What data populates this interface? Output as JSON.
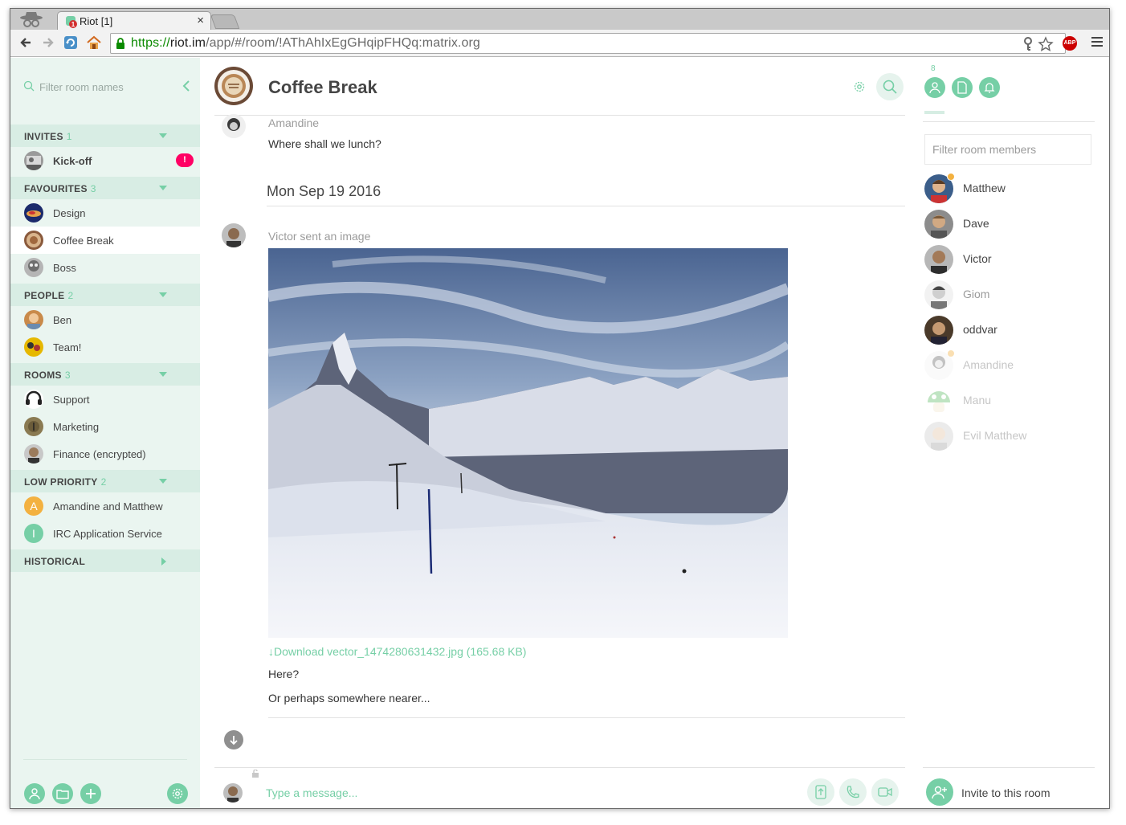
{
  "browser": {
    "tab_title": "Riot [1]",
    "tab_close": "×",
    "url_scheme": "https://",
    "url_host": "riot.im",
    "url_path": "/app/#/room/!AThAhIxEgGHqipFHQq:matrix.org",
    "abp_label": "ABP"
  },
  "left": {
    "filter_placeholder": "Filter room names",
    "sections": {
      "invites": {
        "label": "INVITES",
        "count": "1"
      },
      "favourites": {
        "label": "FAVOURITES",
        "count": "3"
      },
      "people": {
        "label": "PEOPLE",
        "count": "2"
      },
      "rooms": {
        "label": "ROOMS",
        "count": "3"
      },
      "low_priority": {
        "label": "LOW PRIORITY",
        "count": "2"
      },
      "historical": {
        "label": "HISTORICAL"
      }
    },
    "rooms": {
      "kickoff": {
        "name": "Kick-off",
        "badge": "!"
      },
      "design": {
        "name": "Design"
      },
      "coffee": {
        "name": "Coffee Break"
      },
      "boss": {
        "name": "Boss"
      },
      "ben": {
        "name": "Ben"
      },
      "team": {
        "name": "Team!"
      },
      "support": {
        "name": "Support"
      },
      "marketing": {
        "name": "Marketing"
      },
      "finance": {
        "name": "Finance (encrypted)"
      },
      "amandine_matthew": {
        "name": "Amandine and Matthew",
        "letter": "A"
      },
      "irc": {
        "name": "IRC Application Service",
        "letter": "I"
      }
    }
  },
  "room": {
    "name": "Coffee Break"
  },
  "timeline": {
    "evt1_sender": "Amandine",
    "evt1_body": "Where shall we lunch?",
    "date": "Mon Sep 19 2016",
    "evt2_sender": "Victor sent an image",
    "download": "Download vector_1474280631432.jpg (165.68 KB)",
    "evt3_body": "Here?",
    "evt4_body": "Or perhaps somewhere nearer..."
  },
  "composer": {
    "placeholder": "Type a message..."
  },
  "right": {
    "member_count": "8",
    "filter_placeholder": "Filter room members",
    "members": [
      {
        "name": "Matthew"
      },
      {
        "name": "Dave"
      },
      {
        "name": "Victor"
      },
      {
        "name": "Giom"
      },
      {
        "name": "oddvar"
      },
      {
        "name": "Amandine"
      },
      {
        "name": "Manu"
      },
      {
        "name": "Evil Matthew"
      }
    ],
    "invite_label": "Invite to this room"
  },
  "colors": {
    "accent": "#76cfa6",
    "sidebar_bg": "#eaf5f0",
    "section_bg": "#d8ede4",
    "badge": "#ff0064",
    "text": "#454545"
  },
  "icons": [
    "incognito-icon",
    "back-icon",
    "forward-icon",
    "reload-icon",
    "home-icon",
    "lock-icon",
    "key-icon",
    "star-icon",
    "menu-icon",
    "search-icon",
    "collapse-icon",
    "settings-icon",
    "people-icon",
    "files-icon",
    "bell-icon",
    "upload-icon",
    "phone-icon",
    "video-icon",
    "add-user-icon"
  ]
}
